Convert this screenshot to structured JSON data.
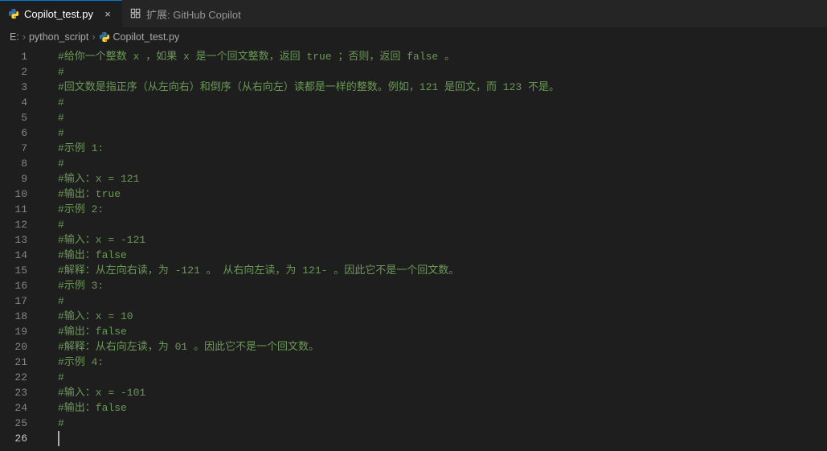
{
  "tabs": [
    {
      "label": "Copilot_test.py",
      "type": "python",
      "close": "×"
    },
    {
      "label": "扩展: GitHub Copilot",
      "type": "extension"
    }
  ],
  "breadcrumb": {
    "seg0": "E:",
    "seg1": "python_script",
    "seg2": "Copilot_test.py",
    "sep": "›"
  },
  "gutter": {
    "1": "1",
    "2": "2",
    "3": "3",
    "4": "4",
    "5": "5",
    "6": "6",
    "7": "7",
    "8": "8",
    "9": "9",
    "10": "10",
    "11": "11",
    "12": "12",
    "13": "13",
    "14": "14",
    "15": "15",
    "16": "16",
    "17": "17",
    "18": "18",
    "19": "19",
    "20": "20",
    "21": "21",
    "22": "22",
    "23": "23",
    "24": "24",
    "25": "25",
    "26": "26"
  },
  "code": {
    "1": "#给你一个整数 x ，如果 x 是一个回文整数，返回 true ；否则，返回 false 。",
    "2": "#",
    "3": "#回文数是指正序（从左向右）和倒序（从右向左）读都是一样的整数。例如，121 是回文，而 123 不是。",
    "4": "#",
    "5": "#",
    "6": "#",
    "7": "#示例 1:",
    "8": "#",
    "9": "#输入：x = 121",
    "10": "#输出：true",
    "11": "#示例 2:",
    "12": "#",
    "13": "#输入：x = -121",
    "14": "#输出：false",
    "15": "#解释：从左向右读，为 -121 。 从右向左读，为 121- 。因此它不是一个回文数。",
    "16": "#示例 3:",
    "17": "#",
    "18": "#输入：x = 10",
    "19": "#输出：false",
    "20": "#解释：从右向左读，为 01 。因此它不是一个回文数。",
    "21": "#示例 4:",
    "22": "#",
    "23": "#输入：x = -101",
    "24": "#输出：false",
    "25": "#",
    "26": ""
  }
}
